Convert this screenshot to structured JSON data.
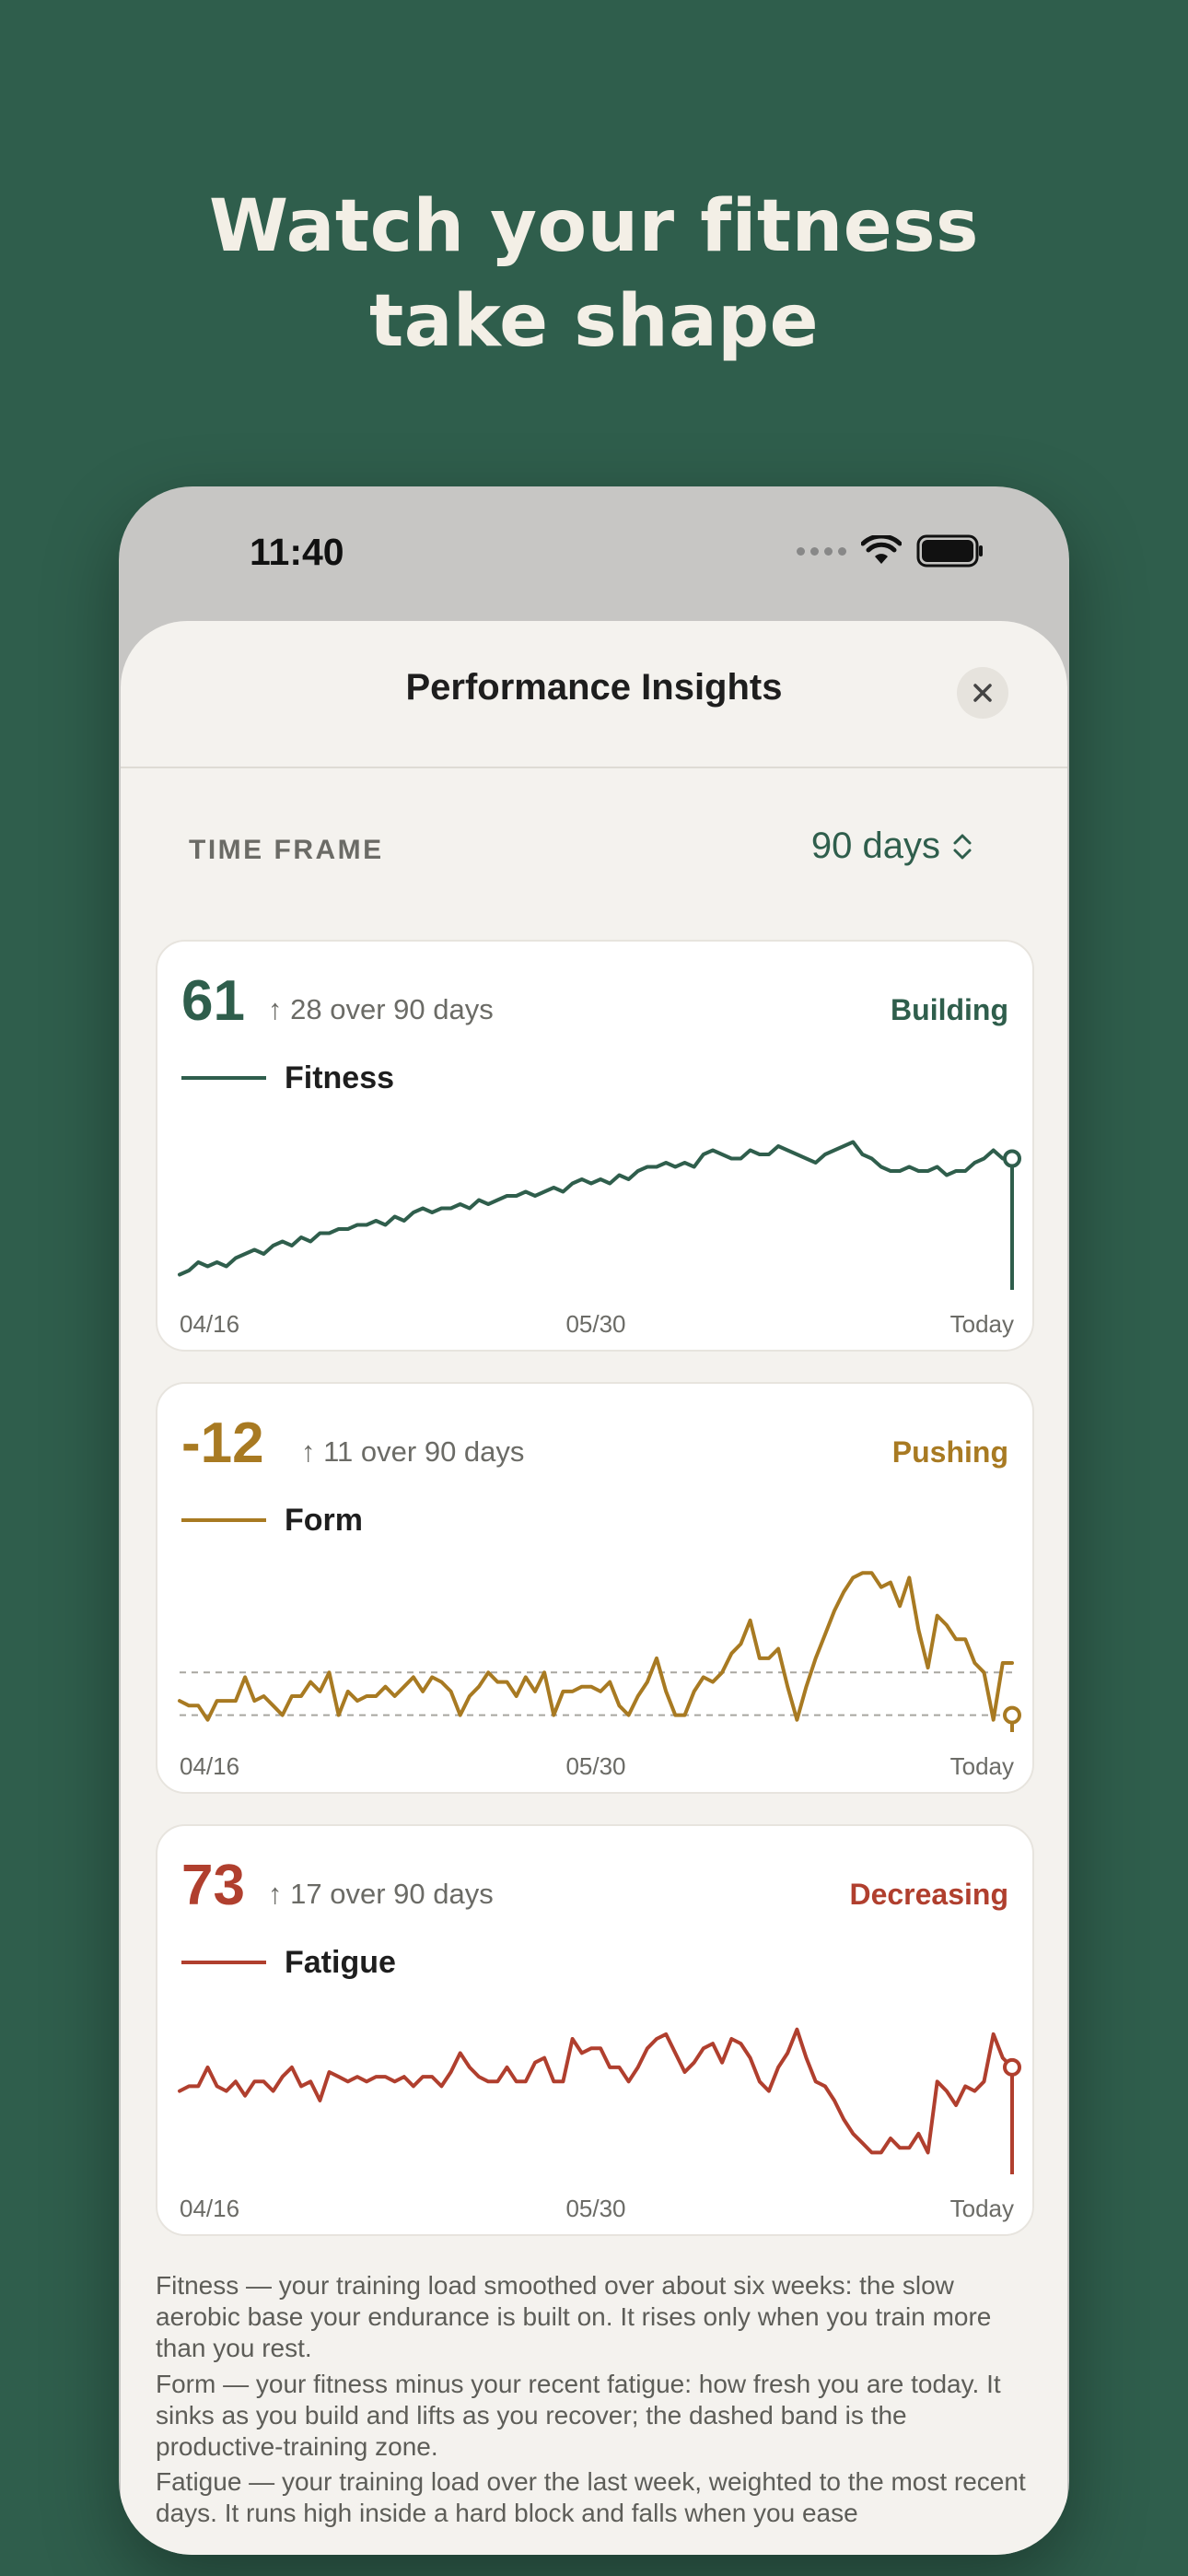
{
  "headline": {
    "line1": "Watch your fitness",
    "line2": "take shape"
  },
  "status_bar": {
    "time": "11:40"
  },
  "sheet": {
    "title": "Performance Insights",
    "close_icon": "close-icon"
  },
  "time_frame": {
    "label": "TIME FRAME",
    "value": "90 days",
    "icon": "chevron-updown-icon"
  },
  "cards": [
    {
      "value": "61",
      "delta": "↑ 28 over 90 days",
      "status": "Building",
      "series": "Fitness",
      "color": "#2f5e4c"
    },
    {
      "value": "-12",
      "delta": "↑ 11 over 90 days",
      "status": "Pushing",
      "series": "Form",
      "color": "#a87a22"
    },
    {
      "value": "73",
      "delta": "↑ 17 over 90 days",
      "status": "Decreasing",
      "series": "Fatigue",
      "color": "#b03f2e"
    }
  ],
  "explainers": [
    "Fitness — your training load smoothed over about six weeks: the slow aerobic base your endurance is built on. It rises only when you train more than you rest.",
    "Form — your fitness minus your recent fatigue: how fresh you are today. It sinks as you build and lifts as you recover; the dashed band is the productive-training zone.",
    "Fatigue — your training load over the last week, weighted to the most recent days. It runs high inside a hard block and falls when you ease"
  ],
  "chart_data": [
    {
      "type": "line",
      "series": [
        {
          "name": "Fitness",
          "values": [
            33,
            34,
            36,
            35,
            36,
            35,
            37,
            38,
            39,
            38,
            40,
            41,
            40,
            42,
            41,
            43,
            43,
            44,
            44,
            45,
            45,
            46,
            45,
            47,
            46,
            48,
            49,
            48,
            49,
            49,
            50,
            49,
            51,
            50,
            51,
            52,
            52,
            53,
            52,
            53,
            54,
            53,
            55,
            56,
            55,
            56,
            55,
            57,
            56,
            58,
            59,
            59,
            60,
            59,
            60,
            59,
            62,
            63,
            62,
            61,
            61,
            63,
            62,
            62,
            64,
            63,
            62,
            61,
            60,
            62,
            63,
            64,
            65,
            62,
            61,
            59,
            58,
            58,
            59,
            58,
            58,
            59,
            57,
            58,
            58,
            60,
            61,
            63,
            61,
            61
          ]
        }
      ],
      "x_tick_labels": [
        "04/16",
        "05/30",
        "Today"
      ],
      "last_value": 61,
      "grid": false
    },
    {
      "type": "line",
      "series": [
        {
          "name": "Form",
          "values": [
            -9,
            -10,
            -10,
            -13,
            -9,
            -9,
            -9,
            -4,
            -9,
            -8,
            -10,
            -12,
            -8,
            -8,
            -5,
            -7,
            -3,
            -12,
            -7,
            -9,
            -8,
            -8,
            -6,
            -8,
            -6,
            -4,
            -7,
            -4,
            -5,
            -7,
            -12,
            -8,
            -6,
            -3,
            -5,
            -5,
            -8,
            -4,
            -7,
            -3,
            -12,
            -7,
            -7,
            -6,
            -6,
            -7,
            -5,
            -10,
            -12,
            -8,
            -5,
            0,
            -7,
            -12,
            -12,
            -7,
            -4,
            -5,
            -3,
            1,
            3,
            8,
            0,
            0,
            2,
            -6,
            -13,
            -6,
            0,
            5,
            10,
            14,
            17,
            18,
            18,
            15,
            16,
            11,
            17,
            6,
            -2,
            9,
            7,
            4,
            4,
            -1,
            -3,
            -13,
            -1,
            -1
          ]
        }
      ],
      "x_tick_labels": [
        "04/16",
        "05/30",
        "Today"
      ],
      "dashed_band": [
        -12,
        -3
      ],
      "last_value": -12,
      "grid": false
    },
    {
      "type": "line",
      "series": [
        {
          "name": "Fatigue",
          "values": [
            42,
            43,
            43,
            47,
            43,
            42,
            44,
            41,
            44,
            44,
            42,
            45,
            47,
            43,
            44,
            40,
            46,
            45,
            44,
            45,
            44,
            45,
            45,
            44,
            45,
            43,
            45,
            45,
            43,
            46,
            50,
            47,
            45,
            44,
            44,
            47,
            44,
            44,
            48,
            49,
            44,
            44,
            53,
            50,
            51,
            51,
            47,
            47,
            44,
            47,
            51,
            53,
            54,
            50,
            46,
            48,
            51,
            52,
            48,
            53,
            52,
            49,
            44,
            42,
            47,
            50,
            55,
            49,
            44,
            43,
            40,
            36,
            33,
            31,
            29,
            29,
            32,
            30,
            30,
            33,
            29,
            44,
            42,
            39,
            43,
            42,
            44,
            54,
            49,
            47
          ]
        }
      ],
      "x_tick_labels": [
        "04/16",
        "05/30",
        "Today"
      ],
      "last_value": 47,
      "grid": false
    }
  ]
}
